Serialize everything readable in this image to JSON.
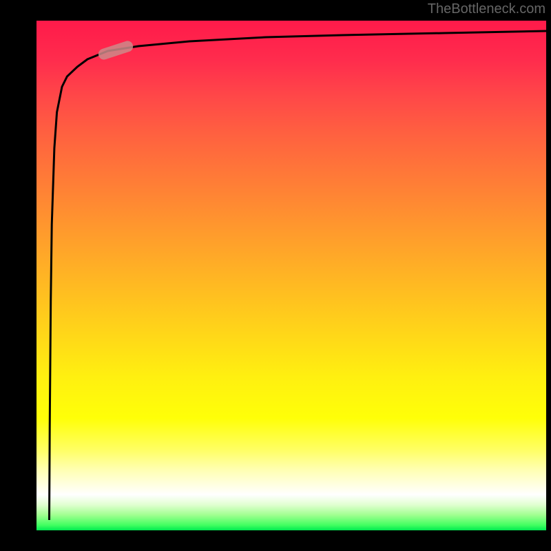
{
  "watermark": "TheBottleneck.com",
  "chart_data": {
    "type": "line",
    "title": "",
    "xlabel": "",
    "ylabel": "",
    "xlim": [
      0,
      100
    ],
    "ylim": [
      0,
      100
    ],
    "series": [
      {
        "name": "curve",
        "x": [
          2.5,
          2.6,
          2.8,
          3.0,
          3.5,
          4.0,
          5.0,
          6.0,
          8.0,
          10.0,
          14.0,
          20.0,
          30.0,
          45.0,
          60.0,
          80.0,
          100.0
        ],
        "y": [
          2,
          20,
          45,
          60,
          75,
          82,
          87,
          89,
          91,
          92.5,
          94,
          95,
          96,
          96.8,
          97.2,
          97.6,
          98
        ]
      }
    ],
    "marker": {
      "x": 15.5,
      "y": 94.3,
      "angle": -25
    },
    "background_gradient": {
      "type": "vertical",
      "stops": [
        {
          "pos": 0,
          "color": "#ff1a4a"
        },
        {
          "pos": 50,
          "color": "#ffc020"
        },
        {
          "pos": 80,
          "color": "#ffff08"
        },
        {
          "pos": 93,
          "color": "#ffffff"
        },
        {
          "pos": 100,
          "color": "#00e850"
        }
      ]
    }
  }
}
